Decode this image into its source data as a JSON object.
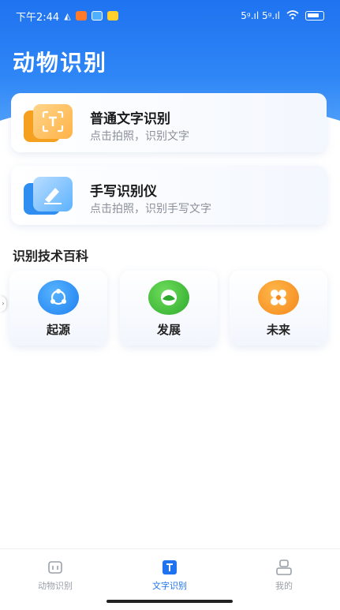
{
  "status_bar": {
    "time": "下午2:44",
    "signal": "5ᵍ.ıl 5ᵍ.ıl",
    "battery_label": "battery"
  },
  "header": {
    "title": "动物识别"
  },
  "cards": [
    {
      "title": "普通文字识别",
      "subtitle": "点击拍照，识别文字",
      "icon": "text-scan-icon",
      "color": "#f6a020"
    },
    {
      "title": "手写识别仪",
      "subtitle": "点击拍照，识别手写文字",
      "icon": "handwriting-icon",
      "color": "#2f8ef0"
    }
  ],
  "section": {
    "title": "识别技术百科"
  },
  "tiles": [
    {
      "label": "起源",
      "icon": "origin-icon",
      "color": "#1d7ff0"
    },
    {
      "label": "发展",
      "icon": "development-icon",
      "color": "#2daa2d"
    },
    {
      "label": "未来",
      "icon": "future-icon",
      "color": "#f5861a"
    }
  ],
  "tab_bar": {
    "items": [
      {
        "label": "动物识别",
        "icon": "animal-id-icon",
        "active": false
      },
      {
        "label": "文字识别",
        "icon": "text-id-icon",
        "active": true
      },
      {
        "label": "我的",
        "icon": "profile-icon",
        "active": false
      }
    ]
  },
  "colors": {
    "brand_blue": "#1f73f0",
    "inactive_gray": "#9aa0a8"
  }
}
